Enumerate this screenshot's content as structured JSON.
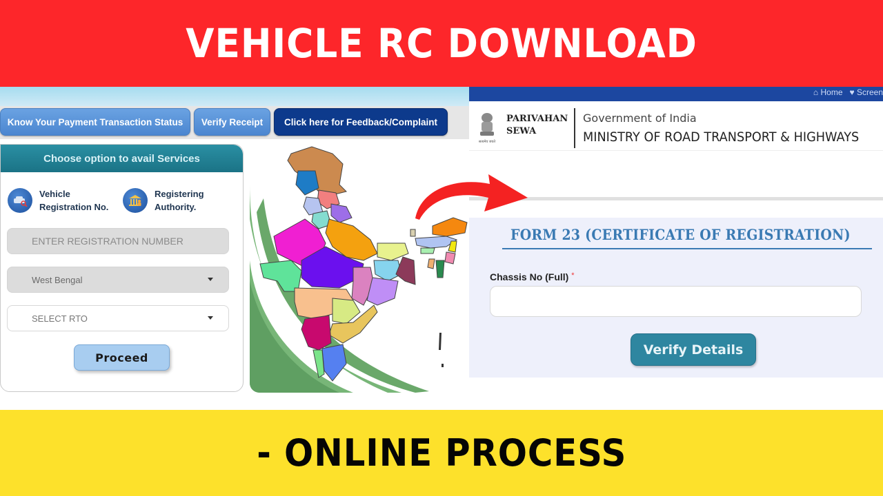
{
  "banner": {
    "title": "VEHICLE RC DOWNLOAD",
    "subtitle": "- ONLINE PROCESS",
    "title_bg": "#fd262a",
    "subtitle_bg": "#fde12b"
  },
  "vahan": {
    "nav_buttons": [
      {
        "label": "Know Your Payment Transaction Status"
      },
      {
        "label": "Verify Receipt"
      },
      {
        "label": "Click here for Feedback/Complaint"
      }
    ],
    "card": {
      "header": "Choose option to avail Services",
      "options": [
        {
          "label_line1": "Vehicle",
          "label_line2": "Registration No.",
          "icon": "car-search-icon"
        },
        {
          "label_line1": "Registering",
          "label_line2": "Authority.",
          "icon": "bank-building-icon"
        }
      ],
      "registration_placeholder": "ENTER REGISTRATION NUMBER",
      "state_select": "West Bengal",
      "rto_select": "SELECT RTO",
      "proceed_label": "Proceed"
    },
    "map_alt": "India states map"
  },
  "parivahan": {
    "top_links": [
      {
        "icon": "home-icon",
        "label": "Home"
      },
      {
        "icon": "screen-reader-icon",
        "label": "Screen"
      }
    ],
    "brand_line1": "PARIVAHAN",
    "brand_line2": "SEWA",
    "emblem_caption": "सत्यमेव जयते",
    "gov": "Government of India",
    "ministry": "MINISTRY OF ROAD TRANSPORT & HIGHWAYS",
    "form_title": "FORM 23 (CERTIFICATE OF REGISTRATION)",
    "chassis_label": "Chassis No (Full)",
    "required_mark": "*",
    "chassis_value": "",
    "verify_label": "Verify Details"
  }
}
